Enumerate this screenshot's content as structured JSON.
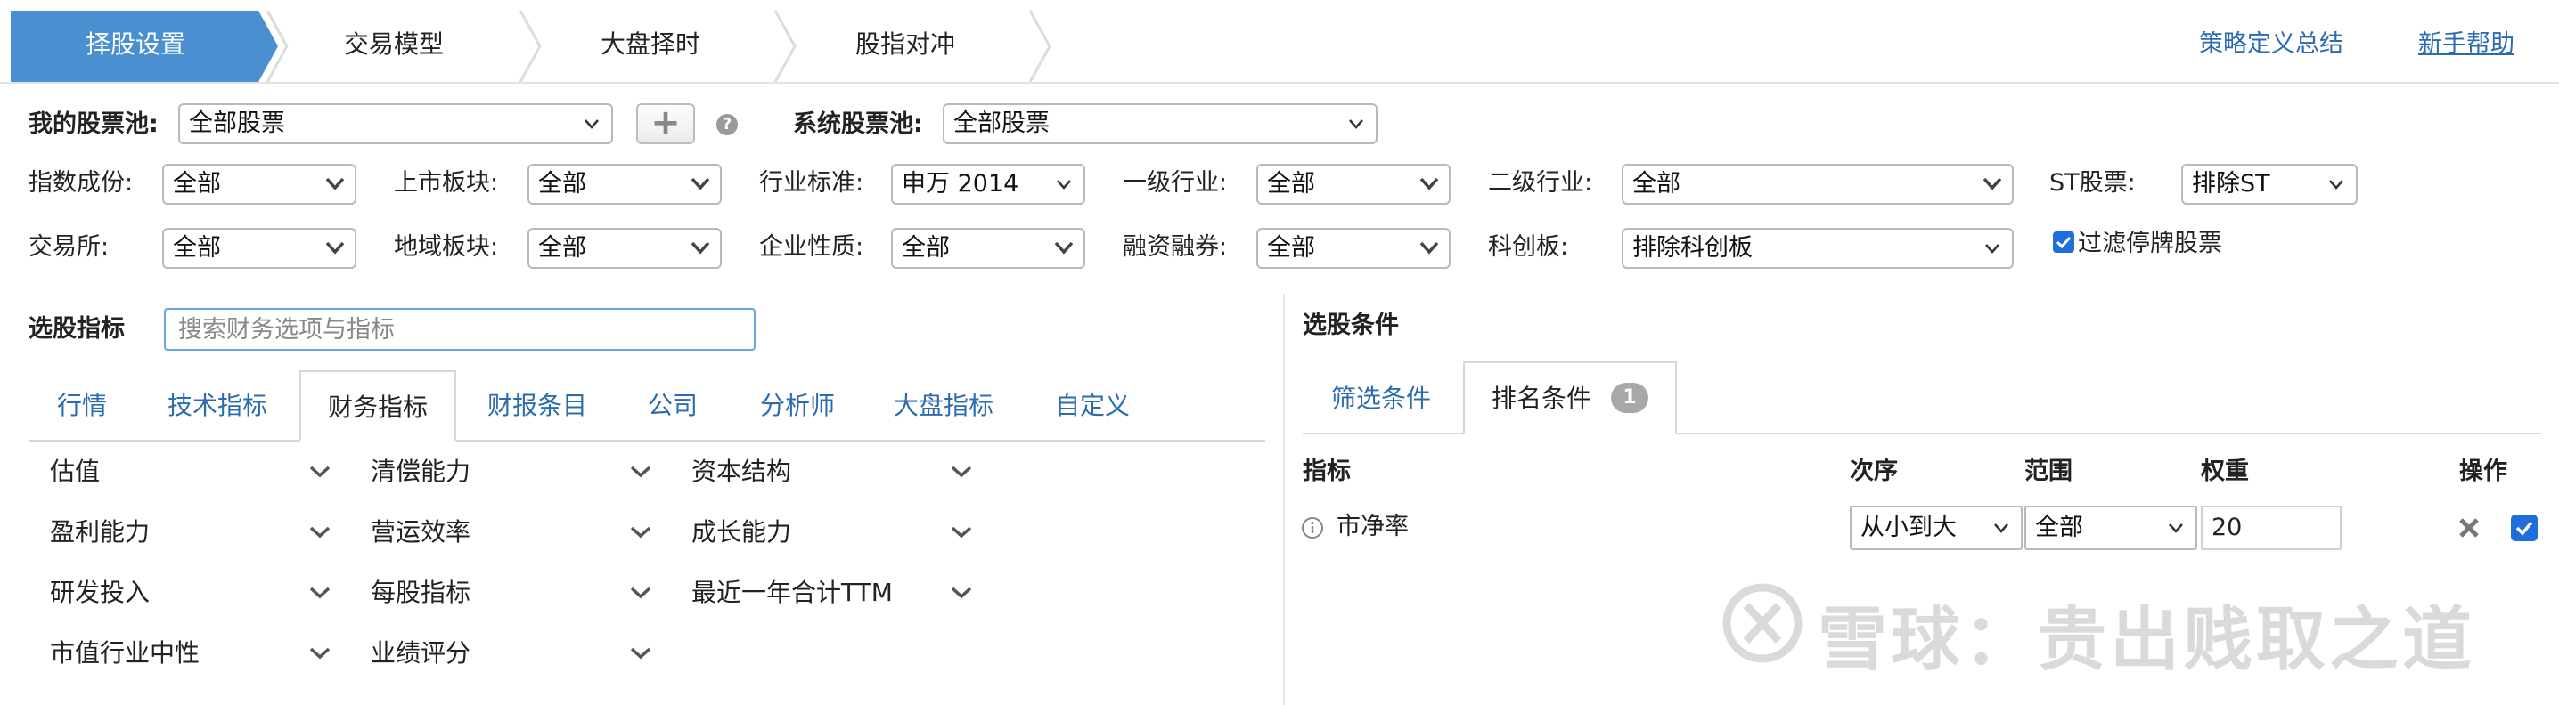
{
  "steps": [
    {
      "label": "择股设置",
      "active": true
    },
    {
      "label": "交易模型",
      "active": false
    },
    {
      "label": "大盘择时",
      "active": false
    },
    {
      "label": "股指对冲",
      "active": false
    }
  ],
  "top_links": {
    "strategy_summary": "策略定义总结",
    "help": "新手帮助"
  },
  "pool": {
    "my_label": "我的股票池:",
    "my_value": "全部股票",
    "add_symbol": "+",
    "help_symbol": "?",
    "system_label": "系统股票池:",
    "system_value": "全部股票"
  },
  "filters_row1": [
    {
      "label": "指数成份:",
      "value": "全部"
    },
    {
      "label": "上市板块:",
      "value": "全部"
    },
    {
      "label": "行业标准:",
      "value": "申万 2014"
    },
    {
      "label": "一级行业:",
      "value": "全部"
    },
    {
      "label": "二级行业:",
      "value": "全部"
    },
    {
      "label": "ST股票:",
      "value": "排除ST"
    }
  ],
  "filters_row2": [
    {
      "label": "交易所:",
      "value": "全部"
    },
    {
      "label": "地域板块:",
      "value": "全部"
    },
    {
      "label": "企业性质:",
      "value": "全部"
    },
    {
      "label": "融资融券:",
      "value": "全部"
    },
    {
      "label": "科创板:",
      "value": "排除科创板"
    }
  ],
  "filter_suspended": {
    "label": "过滤停牌股票",
    "checked": true
  },
  "indicators": {
    "title": "选股指标",
    "search_placeholder": "搜索财务选项与指标",
    "tabs": [
      "行情",
      "技术指标",
      "财务指标",
      "财报条目",
      "公司",
      "分析师",
      "大盘指标",
      "自定义"
    ],
    "active_tab": "财务指标",
    "categories": [
      [
        "估值",
        "清偿能力",
        "资本结构"
      ],
      [
        "盈利能力",
        "营运效率",
        "成长能力"
      ],
      [
        "研发投入",
        "每股指标",
        "最近一年合计TTM"
      ],
      [
        "市值行业中性",
        "业绩评分"
      ]
    ]
  },
  "conditions": {
    "title": "选股条件",
    "tabs": [
      {
        "label": "筛选条件",
        "active": false
      },
      {
        "label": "排名条件",
        "active": true,
        "badge": "1"
      }
    ],
    "headers": {
      "indicator": "指标",
      "order": "次序",
      "range": "范围",
      "weight": "权重",
      "action": "操作"
    },
    "rows": [
      {
        "indicator": "市净率",
        "order": "从小到大",
        "range": "全部",
        "weight": "20",
        "checked": true
      }
    ]
  },
  "watermark": {
    "text": "雪球：贵出贱取之道"
  },
  "colors": {
    "accent": "#4a90d0",
    "link": "#2b6cb0",
    "checkbox": "#1e6fd9"
  }
}
